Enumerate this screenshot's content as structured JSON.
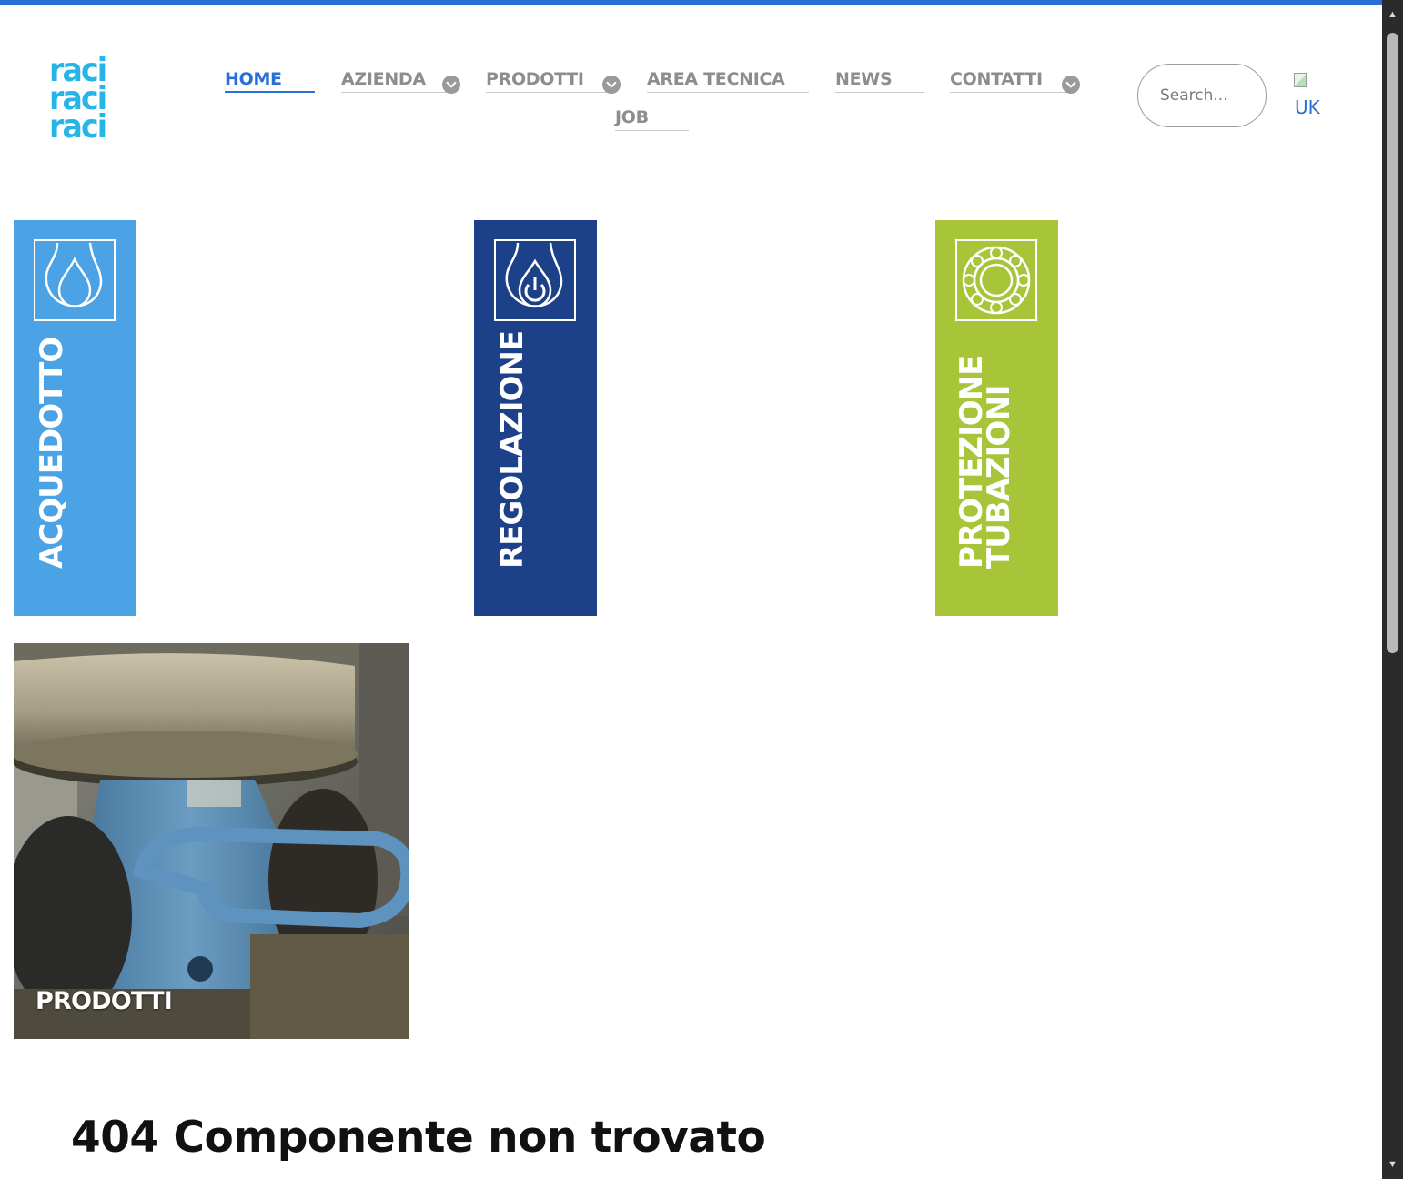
{
  "header": {
    "accent_color": "#2a6fd6",
    "logo_text": [
      "raci",
      "raci",
      "raci"
    ],
    "logo_color": "#27b5e8"
  },
  "nav": {
    "home": "HOME",
    "azienda": "AZIENDA",
    "prodotti": "PRODOTTI",
    "area_tecnica": "AREA TECNICA",
    "news": "NEWS",
    "contatti": "CONTATTI",
    "job": "JOB"
  },
  "search": {
    "placeholder": "Search..."
  },
  "language": {
    "alt_text": "UK"
  },
  "categories": [
    {
      "label": "ACQUEDOTTO",
      "color": "#4ba3e5",
      "icon": "water-drop-icon"
    },
    {
      "label": "REGOLAZIONE",
      "color": "#1d4189",
      "icon": "power-drop-icon"
    },
    {
      "label_line1": "PROTEZIONE",
      "label_line2": "TUBAZIONI",
      "color": "#a8c539",
      "icon": "flower-ring-icon"
    }
  ],
  "product_tile": {
    "label": "PRODOTTI"
  },
  "error": {
    "title": "404 Componente non trovato"
  }
}
